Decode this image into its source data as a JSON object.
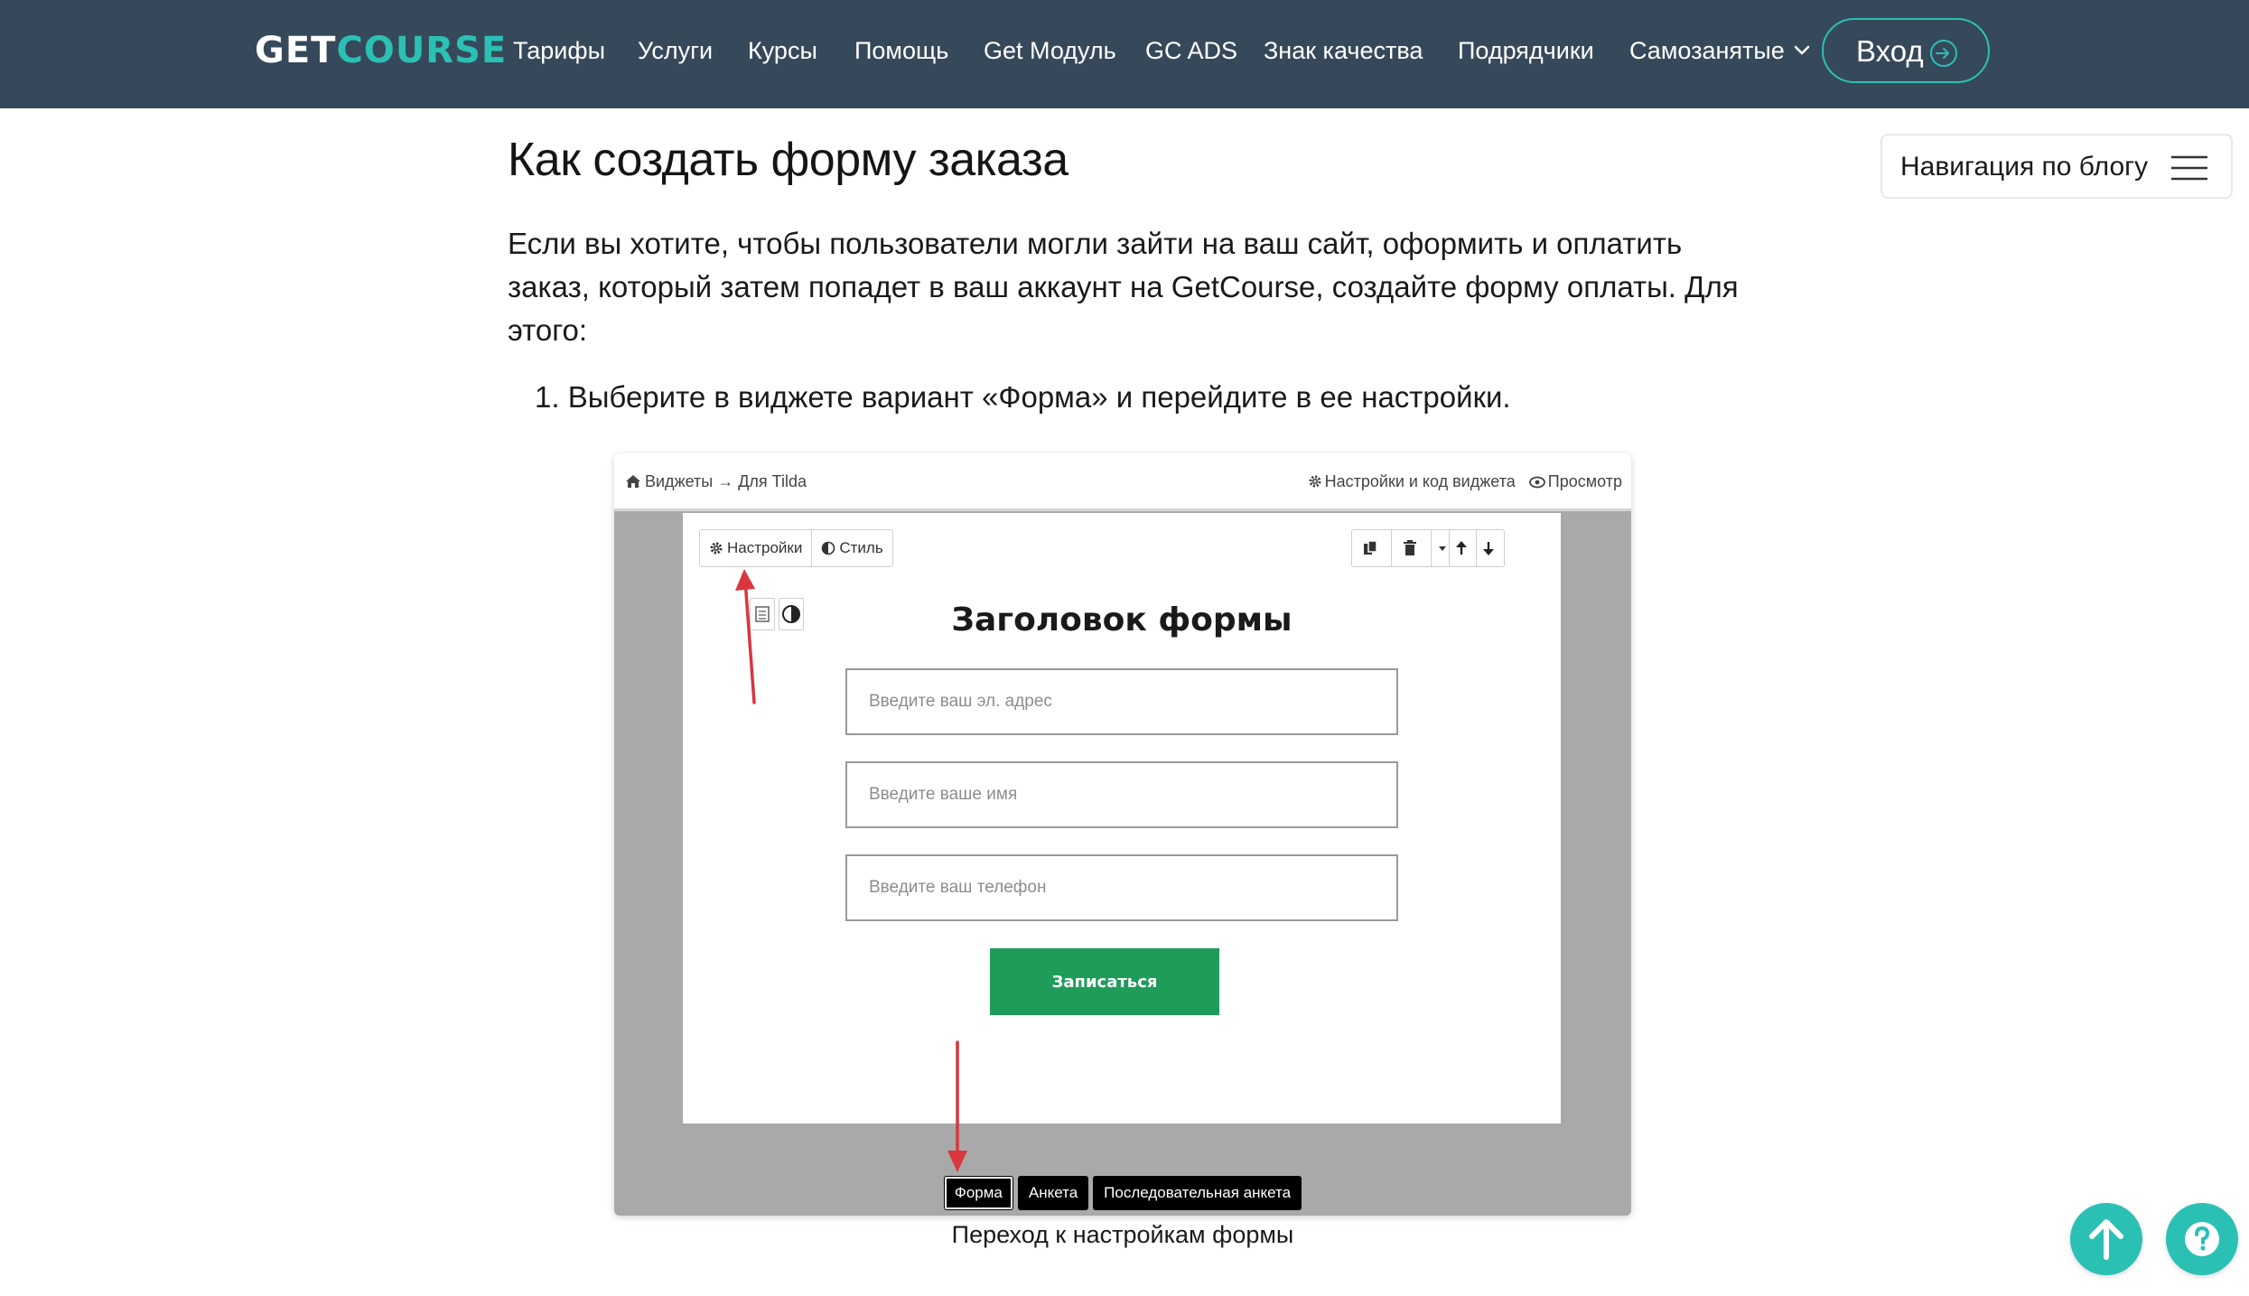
{
  "header": {
    "logo": {
      "part1": "GET",
      "part2": "COURSE"
    },
    "nav": [
      {
        "label": "Тарифы"
      },
      {
        "label": "Услуги"
      },
      {
        "label": "Курсы"
      },
      {
        "label": "Помощь"
      },
      {
        "label": "Get Модуль"
      },
      {
        "label": "GC ADS"
      },
      {
        "label": "Знак качества"
      },
      {
        "label": "Подрядчики"
      },
      {
        "label": "Самозанятые"
      }
    ],
    "login_label": "Вход"
  },
  "article": {
    "title": "Как создать форму заказа",
    "intro_lines": [
      "Если вы хотите, чтобы пользователи могли зайти на ваш сайт, оформить и оплатить",
      "заказ, который затем попадет в ваш аккаунт на GetCourse, создайте форму оплаты. Для",
      "этого:"
    ],
    "step1": "1. Выберите в виджете вариант «Форма» и перейдите в ее настройки."
  },
  "blog_nav": {
    "label": "Навигация по блогу"
  },
  "figure": {
    "breadcrumb": "Виджеты → Для Tilda",
    "top_links": {
      "settings_code": "Настройки и код виджета",
      "preview": "Просмотр"
    },
    "toolbar": {
      "settings": "Настройки",
      "style": "Стиль"
    },
    "form": {
      "title": "Заголовок формы",
      "email_placeholder": "Введите ваш эл. адрес",
      "name_placeholder": "Введите ваше имя",
      "phone_placeholder": "Введите ваш телефон",
      "submit": "Записаться"
    },
    "bottom_tabs": [
      {
        "label": "Форма"
      },
      {
        "label": "Анкета"
      },
      {
        "label": "Последовательная анкета"
      }
    ],
    "caption": "Переход к настройкам формы"
  },
  "colors": {
    "header_bg": "#36495a",
    "accent": "#2bc0b4",
    "submit_green": "#1f9b5a",
    "annotation_arrow": "#d9363e"
  }
}
